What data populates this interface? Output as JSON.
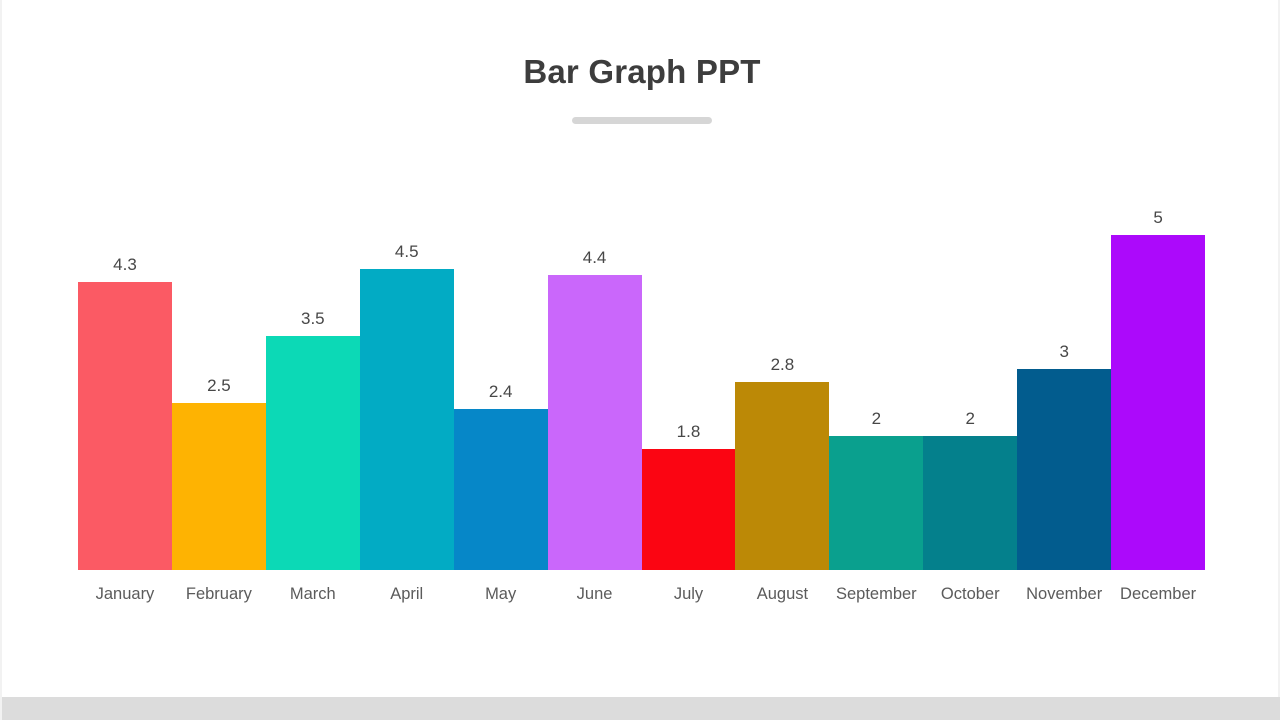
{
  "slide": {
    "title": "Bar Graph PPT",
    "background_color": "#ffffff",
    "divider_color": "#d6d6d6",
    "bottom_strip_color": "#dcdcdc"
  },
  "chart_data": {
    "type": "bar",
    "title": "Bar Graph PPT",
    "xlabel": "",
    "ylabel": "",
    "ylim": [
      0,
      5
    ],
    "grid": false,
    "legend": "none",
    "value_labels_shown": true,
    "categories": [
      "January",
      "February",
      "March",
      "April",
      "May",
      "June",
      "July",
      "August",
      "September",
      "October",
      "November",
      "December"
    ],
    "values": [
      4.3,
      2.5,
      3.5,
      4.5,
      2.4,
      4.4,
      1.8,
      2.8,
      2,
      2,
      3,
      5
    ],
    "value_label_text": [
      "4.3",
      "2.5",
      "3.5",
      "4.5",
      "2.4",
      "4.4",
      "1.8",
      "2.8",
      "2",
      "2",
      "3",
      "5"
    ],
    "colors": [
      "#fb5a64",
      "#feb302",
      "#0cd9b6",
      "#02abc4",
      "#0687c8",
      "#ca67fb",
      "#fb0512",
      "#bc8906",
      "#0aa08e",
      "#04808c",
      "#025c8e",
      "#ac09fb"
    ],
    "bars": [
      {
        "category": "January",
        "value": 4.3,
        "label": "4.3",
        "color": "#fb5a64"
      },
      {
        "category": "February",
        "value": 2.5,
        "label": "2.5",
        "color": "#feb302"
      },
      {
        "category": "March",
        "value": 3.5,
        "label": "3.5",
        "color": "#0cd9b6"
      },
      {
        "category": "April",
        "value": 4.5,
        "label": "4.5",
        "color": "#02abc4"
      },
      {
        "category": "May",
        "value": 2.4,
        "label": "2.4",
        "color": "#0687c8"
      },
      {
        "category": "June",
        "value": 4.4,
        "label": "4.4",
        "color": "#ca67fb"
      },
      {
        "category": "July",
        "value": 1.8,
        "label": "1.8",
        "color": "#fb0512"
      },
      {
        "category": "August",
        "value": 2.8,
        "label": "2.8",
        "color": "#bc8906"
      },
      {
        "category": "September",
        "value": 2,
        "label": "2",
        "color": "#0aa08e"
      },
      {
        "category": "October",
        "value": 2,
        "label": "2",
        "color": "#04808c"
      },
      {
        "category": "November",
        "value": 3,
        "label": "3",
        "color": "#025c8e"
      },
      {
        "category": "December",
        "value": 5,
        "label": "5",
        "color": "#ac09fb"
      }
    ]
  }
}
